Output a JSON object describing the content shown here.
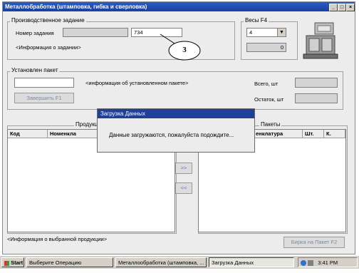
{
  "window": {
    "title": "Металлобработка (штамповка, гибка и сверловка)"
  },
  "production_task": {
    "group_label": "Производственное задание",
    "task_number_label": "Номер задания",
    "task_number_value": "734",
    "task_info": "<Информация о задании>"
  },
  "annotation": {
    "number": "3"
  },
  "scales": {
    "group_label": "Весы  F4",
    "selected": "4",
    "reading": "0"
  },
  "installed_package": {
    "group_label": "Установлен пакет",
    "info": "<информация об установленном пакете>",
    "total_label": "Всего, шт",
    "remaining_label": "Остаток, шт",
    "finish_button": "Завершить     F1"
  },
  "products": {
    "label": "Продукция",
    "columns": [
      "Код",
      "Номенкла"
    ]
  },
  "packages": {
    "label": "Пакеты",
    "columns": [
      "енклатура",
      "Шт.",
      "К."
    ]
  },
  "transfer": {
    "right": ">>",
    "left": "<<"
  },
  "selected_product_info": "<Информация о выбранной продукции>",
  "tag_button": "Бирка на Пакет   F2",
  "dialog": {
    "title": "Загрузка Данных",
    "message": "Данные загружаются, пожалуйста подождите..."
  },
  "taskbar": {
    "start": "Start",
    "items": [
      "Выберите Операцию",
      "Металлообработка (штамповка, ...",
      "Загрузка Данных"
    ],
    "clock": "3:41 PM"
  }
}
